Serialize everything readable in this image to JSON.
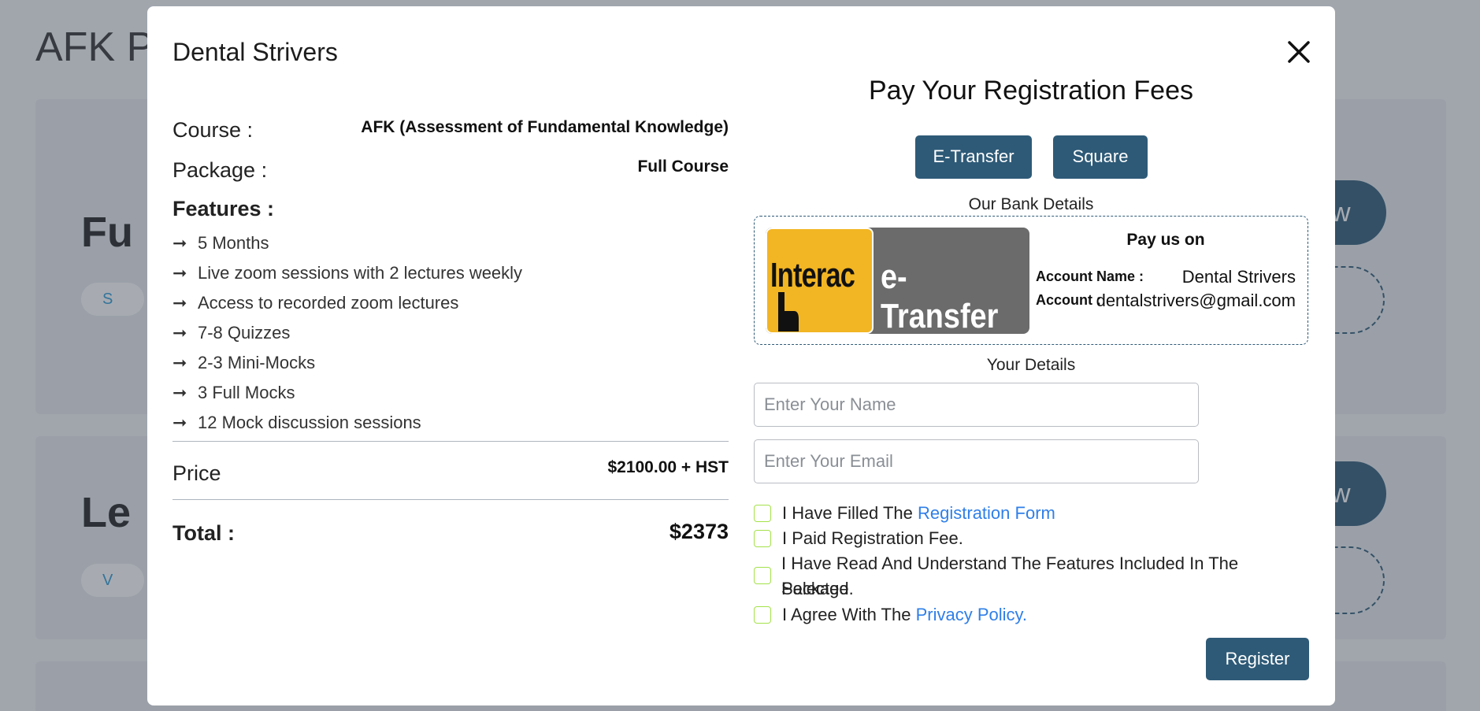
{
  "background": {
    "title": "AFK Pa",
    "card1_heading": "Fu",
    "card1_pill": "S",
    "card1_button": "w",
    "card2_heading": "Le",
    "card2_pill": "V",
    "card2_button": "w"
  },
  "modal": {
    "title": "Dental Strivers",
    "close_label": "×"
  },
  "course": {
    "course_label": "Course :",
    "course_value": "AFK (Assessment of Fundamental Knowledge)",
    "package_label": "Package :",
    "package_value": "Full Course",
    "features_label": "Features :",
    "features": [
      "5 Months",
      "Live zoom sessions with 2 lectures weekly",
      "Access to recorded zoom lectures",
      "7-8 Quizzes",
      "2-3 Mini-Mocks",
      "3 Full Mocks",
      "12 Mock discussion sessions"
    ],
    "price_label": "Price",
    "price_value": "$2100.00 + HST",
    "total_label": "Total :",
    "total_value": "$2373"
  },
  "payment": {
    "title": "Pay Your Registration Fees",
    "tabs": [
      "E-Transfer",
      "Square"
    ],
    "bank_details_label": "Our Bank Details",
    "logo_interac": "Interac",
    "logo_etransfer": "e-Transfer",
    "pay_us_on": "Pay us on",
    "account_name_label": "Account Name :",
    "account_name_value": "Dental Strivers",
    "account_label": "Account :",
    "account_value": "dentalstrivers@gmail.com",
    "your_details_label": "Your Details",
    "name_placeholder": "Enter Your Name",
    "email_placeholder": "Enter Your Email",
    "checks": {
      "c1_text": "I Have Filled The ",
      "c1_link": "Registration Form",
      "c2_text": "I Paid Registration Fee.",
      "c3_line1": "I Have Read And Understand The Features Included In The Selected",
      "c3_line2": "Package.",
      "c4_text": "I Agree With The ",
      "c4_link": "Privacy Policy."
    },
    "register_label": "Register"
  }
}
